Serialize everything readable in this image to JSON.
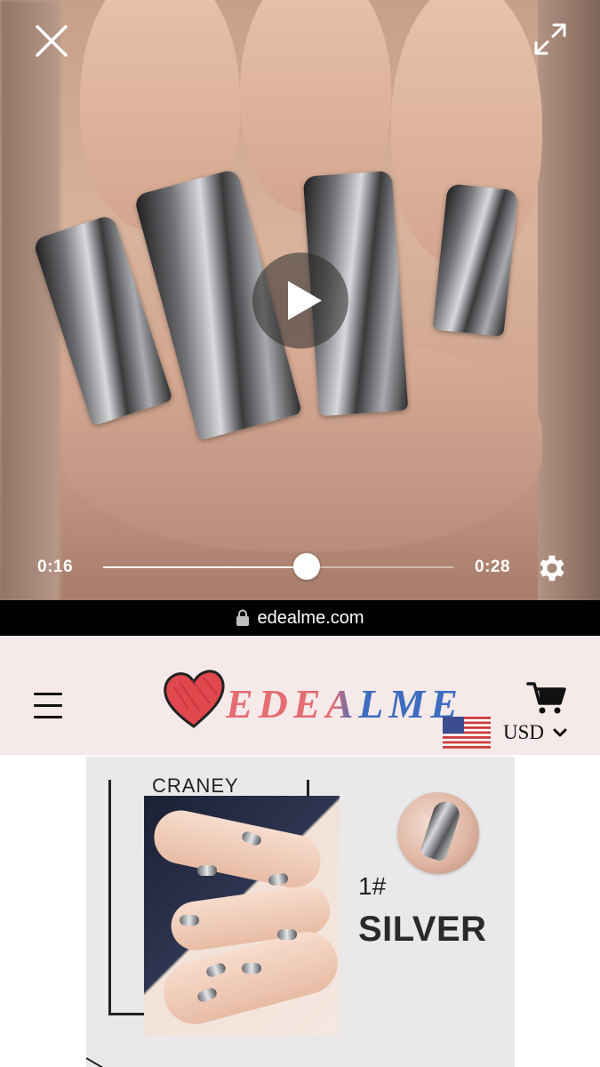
{
  "video": {
    "current_time": "0:16",
    "duration": "0:28",
    "progress": 0.58
  },
  "url_bar": {
    "domain": "edealme.com"
  },
  "header": {
    "logo_text": "EDEALME",
    "currency": "USD"
  },
  "product_image": {
    "brand": "CRANEY",
    "shade_number": "1#",
    "shade_name": "SILVER"
  },
  "colors": {
    "url_bar_bg": "#000000",
    "header_bg": "#f5e9e9",
    "logo_red": "#e46d72",
    "logo_blue": "#3d6dc0"
  },
  "icons": [
    "close-icon",
    "expand-icon",
    "play-icon",
    "settings-gear-icon",
    "lock-icon",
    "hamburger-menu-icon",
    "heart-logo-icon",
    "cart-icon",
    "us-flag-icon",
    "chevron-down-icon"
  ]
}
